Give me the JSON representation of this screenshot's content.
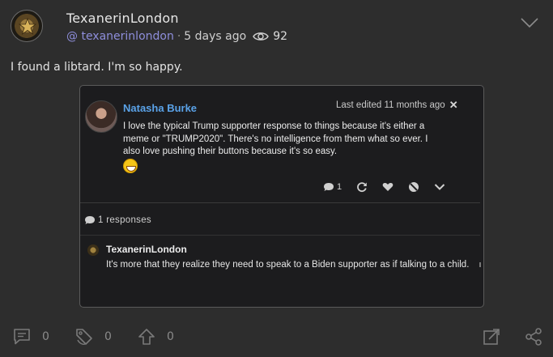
{
  "post": {
    "author": "TexanerinLondon",
    "handle": "@ texanerinlondon",
    "separator": "·",
    "age": "5 days ago",
    "views": "92",
    "text": "I found a libtard. I'm so happy."
  },
  "embed": {
    "author": "Natasha Burke",
    "edited": "Last edited 11 months ago",
    "body": "I love the typical Trump supporter response to things because it's either a meme or \"TRUMP2020\". There's no intelligence from them what so ever. I also love pushing their buttons because it's so easy.",
    "reply_count": "1",
    "responses_label": "1 responses",
    "reply": {
      "author": "TexanerinLondon",
      "body": "It's more that they realize they need to speak to a Biden supporter as if talking to a child."
    }
  },
  "footer": {
    "comments": "0",
    "reposts": "0",
    "upvotes": "0"
  },
  "colors": {
    "background": "#2d2d2d",
    "handle": "#8e8edb",
    "embed_name": "#5aa2e8",
    "embed_bg": "#1c1c1e"
  },
  "icons": [
    "eye-icon",
    "chevron-down-icon",
    "comment-icon",
    "repost-icon",
    "upvote-icon",
    "expand-icon",
    "share-icon",
    "close-icon",
    "refresh-icon",
    "heart-icon",
    "block-icon"
  ]
}
